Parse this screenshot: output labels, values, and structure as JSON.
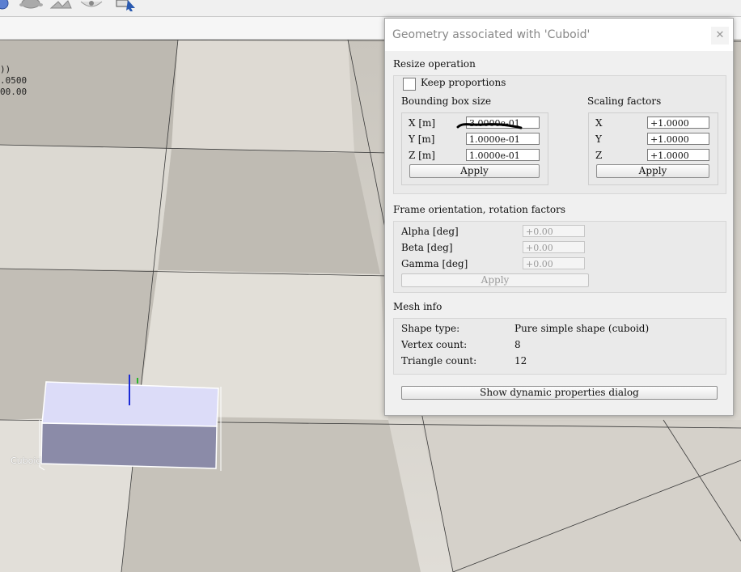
{
  "toolbar": {
    "icons": [
      "cycle-icon",
      "turtle-icon",
      "rabbit-icon",
      "eye-icon",
      "select-cursor-icon"
    ]
  },
  "scene": {
    "readout_lines": [
      "))",
      ".0500",
      "00.00"
    ],
    "object_label": "Cuboid",
    "object_colors": {
      "top": "#dcdcf8",
      "front": "#8b8ba8",
      "side": "#a5a5c2"
    }
  },
  "dialog": {
    "title": "Geometry associated with 'Cuboid'",
    "close_symbol": "✕",
    "resize": {
      "section_title": "Resize operation",
      "keep_proportions_label": "Keep proportions",
      "keep_proportions_checked": false,
      "bbox": {
        "title": "Bounding box size",
        "rows": [
          {
            "label": "X [m]",
            "value": "3.0000e-01"
          },
          {
            "label": "Y [m]",
            "value": "1.0000e-01"
          },
          {
            "label": "Z [m]",
            "value": "1.0000e-01"
          }
        ],
        "apply_label": "Apply"
      },
      "scaling": {
        "title": "Scaling factors",
        "rows": [
          {
            "label": "X",
            "value": "+1.0000"
          },
          {
            "label": "Y",
            "value": "+1.0000"
          },
          {
            "label": "Z",
            "value": "+1.0000"
          }
        ],
        "apply_label": "Apply"
      }
    },
    "frame": {
      "section_title": "Frame orientation, rotation factors",
      "rows": [
        {
          "label": "Alpha [deg]",
          "value": "+0.00"
        },
        {
          "label": "Beta [deg]",
          "value": "+0.00"
        },
        {
          "label": "Gamma [deg]",
          "value": "+0.00"
        }
      ],
      "apply_label": "Apply"
    },
    "mesh": {
      "section_title": "Mesh info",
      "rows": [
        {
          "label": "Shape type:",
          "value": "Pure simple shape (cuboid)"
        },
        {
          "label": "Vertex count:",
          "value": "8"
        },
        {
          "label": "Triangle count:",
          "value": "12"
        }
      ]
    },
    "dynamic_button_label": "Show dynamic properties dialog"
  }
}
